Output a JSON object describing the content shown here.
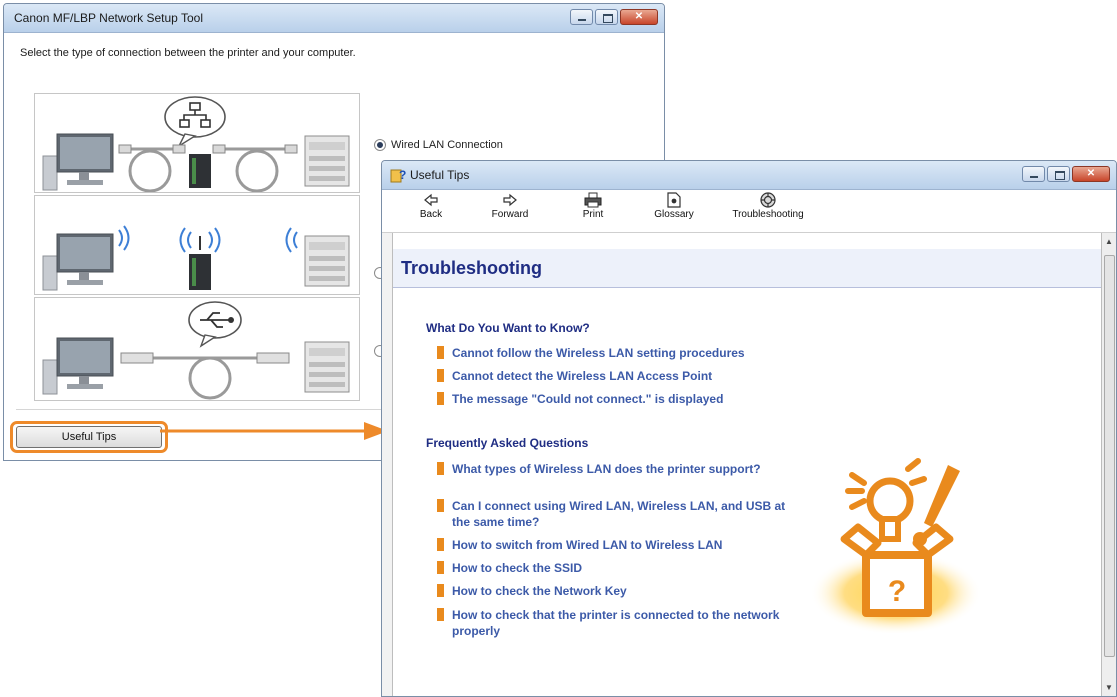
{
  "setup_window": {
    "title": "Canon MF/LBP Network Setup Tool",
    "instruction": "Select the type of connection between the printer and your computer.",
    "options": [
      {
        "label": "Wired LAN Connection",
        "selected": true
      },
      {
        "label": "",
        "selected": false
      },
      {
        "label": "",
        "selected": false
      }
    ],
    "diagram_labels": {
      "usb_left": "",
      "usb_right": ""
    },
    "useful_tips_button": "Useful Tips"
  },
  "tips_window": {
    "title": "Useful Tips",
    "toolbar": [
      {
        "label": "Back",
        "icon": "back-arrow-icon"
      },
      {
        "label": "Forward",
        "icon": "forward-arrow-icon"
      },
      {
        "label": "Print",
        "icon": "printer-icon"
      },
      {
        "label": "Glossary",
        "icon": "glossary-icon"
      },
      {
        "label": "Troubleshooting",
        "icon": "troubleshooting-icon"
      }
    ],
    "page_title": "Troubleshooting",
    "sections": [
      {
        "title": "What Do You Want to Know?",
        "links": [
          "Cannot follow the Wireless LAN setting procedures",
          "Cannot detect the Wireless LAN Access Point",
          "The message \"Could not connect.\" is displayed"
        ]
      },
      {
        "title": "Frequently Asked Questions",
        "links": [
          "What types of Wireless LAN does the printer support?",
          "Can I connect using Wired LAN, Wireless LAN, and USB at the same time?",
          "How to switch from Wired LAN to Wireless LAN",
          "How to check the SSID",
          "How to check the Network Key",
          "How to check that the printer is connected to the network properly"
        ]
      }
    ],
    "illustration_icon": "lightbulb-box-icon"
  },
  "colors": {
    "highlight": "#ee8a2a",
    "title_blue": "#1f2d83",
    "link_blue": "#3c5aa8",
    "bullet_orange": "#e98a1d"
  }
}
